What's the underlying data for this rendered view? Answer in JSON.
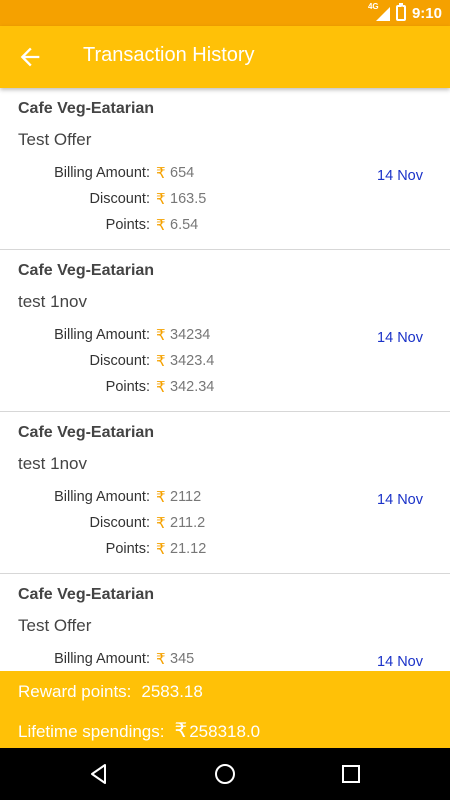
{
  "status_bar": {
    "time": "9:10",
    "network": "4G"
  },
  "header": {
    "title": "Transaction History",
    "back_icon": "arrow-left-icon"
  },
  "currency_symbol": "₹",
  "labels": {
    "billing": "Billing Amount:",
    "discount": "Discount:",
    "points": "Points:"
  },
  "transactions": [
    {
      "shop": "Cafe Veg-Eatarian",
      "offer": "Test Offer",
      "billing": "654",
      "discount": "163.5",
      "points": "6.54",
      "date": "14 Nov"
    },
    {
      "shop": "Cafe Veg-Eatarian",
      "offer": "test 1nov",
      "billing": "34234",
      "discount": "3423.4",
      "points": "342.34",
      "date": "14 Nov"
    },
    {
      "shop": "Cafe Veg-Eatarian",
      "offer": "test 1nov",
      "billing": "2112",
      "discount": "211.2",
      "points": "21.12",
      "date": "14 Nov"
    },
    {
      "shop": "Cafe Veg-Eatarian",
      "offer": "Test Offer",
      "billing": "345",
      "discount": "",
      "points": "",
      "date": "14 Nov"
    }
  ],
  "summary": {
    "reward_label": "Reward points:",
    "reward_value": "2583.18",
    "lifetime_label": "Lifetime spendings:",
    "lifetime_value": "258318.0"
  },
  "nav": {
    "back_icon": "triangle-back-icon",
    "home_icon": "circle-home-icon",
    "recents_icon": "square-recents-icon"
  },
  "colors": {
    "primary": "#ffc107",
    "status": "#f5a100",
    "date": "#1a32c8",
    "rupee": "#f5a100"
  }
}
